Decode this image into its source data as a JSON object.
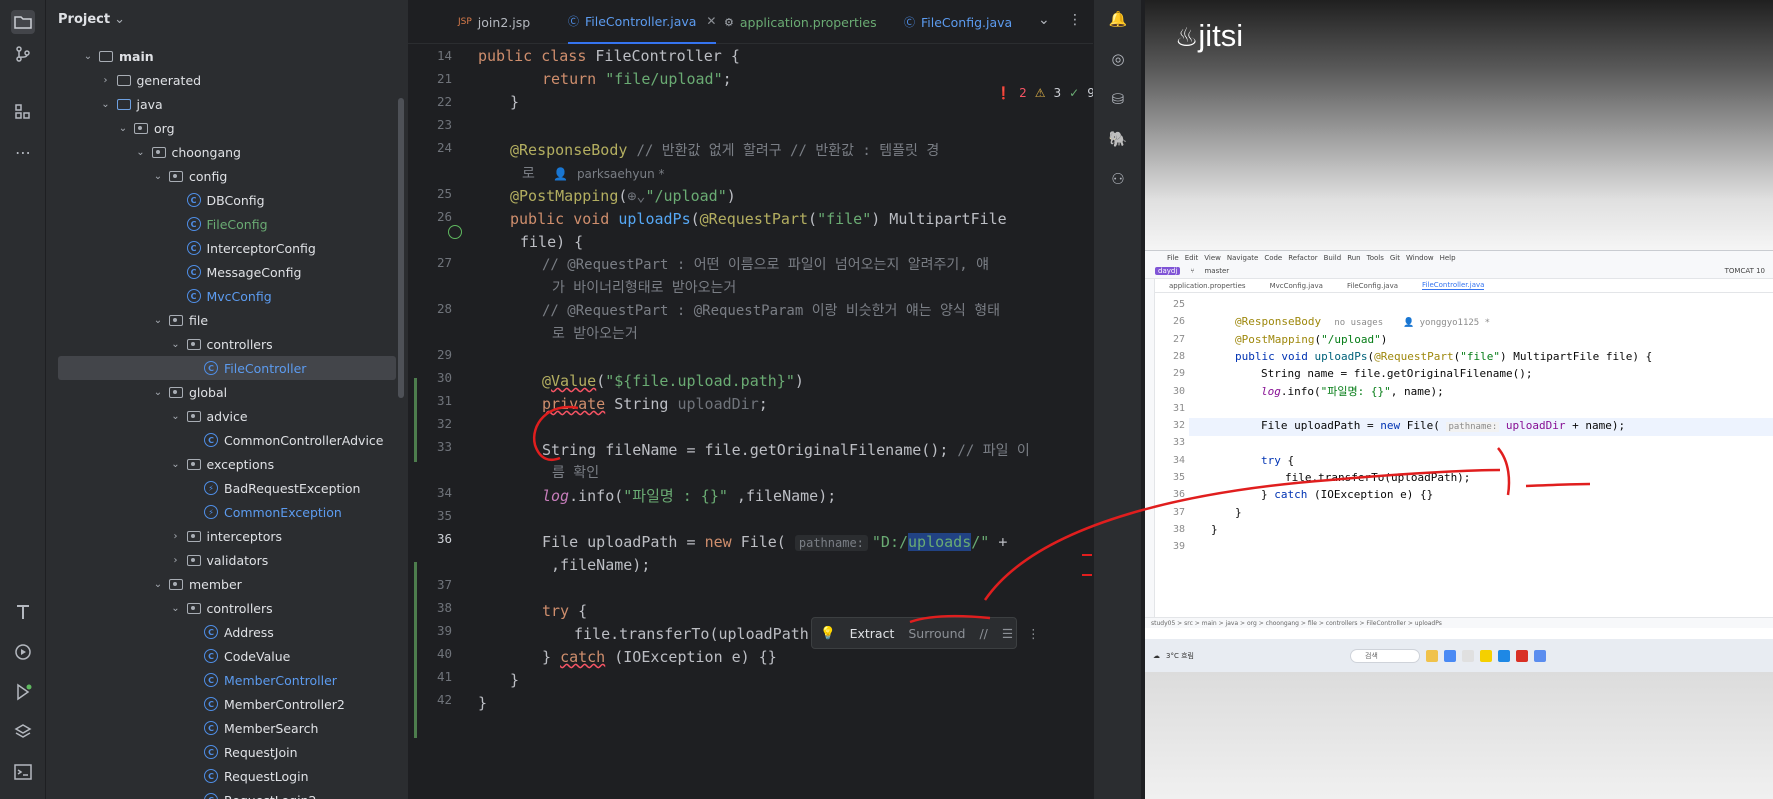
{
  "activity_bar": {
    "icons": [
      "folder-icon",
      "commit-icon",
      "structure-icon",
      "more-icon",
      "build-icon",
      "run-icon",
      "debug-icon",
      "layers-icon",
      "terminal-icon"
    ]
  },
  "project": {
    "title": "Project",
    "tree": [
      {
        "label": "main",
        "depth": 2,
        "kind": "folder",
        "open": true,
        "bold": true
      },
      {
        "label": "generated",
        "depth": 3,
        "kind": "folder"
      },
      {
        "label": "java",
        "depth": 3,
        "kind": "src",
        "open": true
      },
      {
        "label": "org",
        "depth": 4,
        "kind": "pkg",
        "open": true
      },
      {
        "label": "choongang",
        "depth": 5,
        "kind": "pkg",
        "open": true
      },
      {
        "label": "config",
        "depth": 6,
        "kind": "pkg",
        "open": true
      },
      {
        "label": "DBConfig",
        "depth": 7,
        "kind": "class"
      },
      {
        "label": "FileConfig",
        "depth": 7,
        "kind": "class",
        "color": "green"
      },
      {
        "label": "InterceptorConfig",
        "depth": 7,
        "kind": "class"
      },
      {
        "label": "MessageConfig",
        "depth": 7,
        "kind": "class"
      },
      {
        "label": "MvcConfig",
        "depth": 7,
        "kind": "class",
        "color": "blue"
      },
      {
        "label": "file",
        "depth": 6,
        "kind": "pkg",
        "open": true
      },
      {
        "label": "controllers",
        "depth": 7,
        "kind": "pkg",
        "open": true
      },
      {
        "label": "FileController",
        "depth": 8,
        "kind": "class",
        "color": "blue",
        "selected": true
      },
      {
        "label": "global",
        "depth": 6,
        "kind": "pkg",
        "open": true
      },
      {
        "label": "advice",
        "depth": 7,
        "kind": "pkg",
        "open": true
      },
      {
        "label": "CommonControllerAdvice",
        "depth": 8,
        "kind": "class"
      },
      {
        "label": "exceptions",
        "depth": 7,
        "kind": "pkg",
        "open": true
      },
      {
        "label": "BadRequestException",
        "depth": 8,
        "kind": "exc"
      },
      {
        "label": "CommonException",
        "depth": 8,
        "kind": "exc",
        "color": "blue"
      },
      {
        "label": "interceptors",
        "depth": 7,
        "kind": "pkg",
        "open": false
      },
      {
        "label": "validators",
        "depth": 7,
        "kind": "pkg",
        "open": false
      },
      {
        "label": "member",
        "depth": 6,
        "kind": "pkg",
        "open": true
      },
      {
        "label": "controllers",
        "depth": 7,
        "kind": "pkg",
        "open": true
      },
      {
        "label": "Address",
        "depth": 8,
        "kind": "class"
      },
      {
        "label": "CodeValue",
        "depth": 8,
        "kind": "class"
      },
      {
        "label": "MemberController",
        "depth": 8,
        "kind": "class",
        "color": "blue"
      },
      {
        "label": "MemberController2",
        "depth": 8,
        "kind": "class"
      },
      {
        "label": "MemberSearch",
        "depth": 8,
        "kind": "class"
      },
      {
        "label": "RequestJoin",
        "depth": 8,
        "kind": "class"
      },
      {
        "label": "RequestLogin",
        "depth": 8,
        "kind": "class"
      },
      {
        "label": "RequestLogin2",
        "depth": 8,
        "kind": "class"
      }
    ]
  },
  "tabs": [
    {
      "label": "join2.jsp",
      "icon": "JSP",
      "active": false
    },
    {
      "label": "FileController.java",
      "icon": "C",
      "active": true
    },
    {
      "label": "application.properties",
      "icon": "gear",
      "active": false
    },
    {
      "label": "FileConfig.java",
      "icon": "C",
      "active": false
    }
  ],
  "inspections": {
    "errors": "2",
    "warnings": "3",
    "ok": "9"
  },
  "editor": {
    "line_numbers": [
      "14",
      "21",
      "22",
      "23",
      "24",
      "",
      "25",
      "26",
      "",
      "27",
      "",
      "28",
      "",
      "29",
      "30",
      "31",
      "32",
      "33",
      "",
      "34",
      "35",
      "36",
      "",
      "37",
      "38",
      "39",
      "40",
      "41",
      "42"
    ],
    "sticky_header": "public class FileController {",
    "author": "parksaehyun *",
    "comment_24a": "// 반환값 없게 할려구 // 반환값 : 템플릿 경",
    "comment_24b": "로",
    "comment_27a": "// @RequestPart : 어떤 이름으로 파일이 넘어오는지 알려주기, 얘",
    "comment_27b": "가 바이너리형태로 받아오는거",
    "comment_28a": "// @RequestPart : @RequestParam 이랑 비슷한거 얘는 양식 형태",
    "comment_28b": "로 받아오는거",
    "comment_33a": "// 파일 이",
    "comment_33b": "름 확인",
    "log_msg": "\"파일명 : {}\"",
    "hint_pathname": "pathname:",
    "upload_path_str": "\"D:/uploads/\"",
    "popup": {
      "extract": "Extract",
      "surround": "Surround"
    }
  },
  "jitsi": {
    "logo": "jitsi"
  },
  "share": {
    "menu": [
      "File",
      "Edit",
      "View",
      "Navigate",
      "Code",
      "Refactor",
      "Build",
      "Run",
      "Tools",
      "Git",
      "Window",
      "Help"
    ],
    "project": "daydj",
    "branch": "master",
    "run_config": "TOMCAT 10",
    "tabs": [
      "application.properties",
      "MvcConfig.java",
      "FileConfig.java",
      "FileController.java"
    ],
    "author": "yonggyo1125 *",
    "usages": "no usages",
    "line_numbers": [
      "25",
      "26",
      "27",
      "28",
      "29",
      "30",
      "31",
      "32",
      "33",
      "34",
      "35",
      "36",
      "37",
      "38",
      "39"
    ],
    "log_msg": "\"파일명: {}\"",
    "hint_pathname": "pathname:",
    "breadcrumb": "study05 > src > main > java > org > choongang > file > controllers > FileController > uploadPs",
    "search": "검색",
    "weather": "3°C 흐림"
  }
}
